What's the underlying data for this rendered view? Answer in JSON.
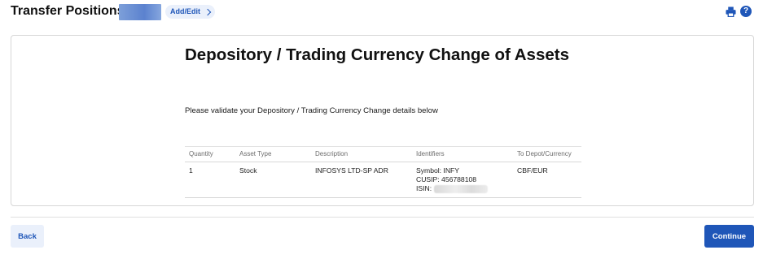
{
  "header": {
    "title": "Transfer Positions",
    "add_edit_label": "Add/Edit"
  },
  "icons": {
    "print": "print-icon",
    "help": "help-icon",
    "help_glyph": "?"
  },
  "card": {
    "title": "Depository / Trading Currency Change of Assets",
    "instructions": "Please validate your Depository / Trading Currency Change details below"
  },
  "table": {
    "headers": [
      "Quantity",
      "Asset Type",
      "Description",
      "Identifiers",
      "To Depot/Currency"
    ],
    "rows": [
      {
        "quantity": "1",
        "asset_type": "Stock",
        "description": "INFOSYS LTD-SP ADR",
        "symbol": "Symbol: INFY",
        "cusip": "CUSIP: 456788108",
        "isin_label": "ISIN:",
        "to_depot": "CBF/EUR"
      }
    ]
  },
  "footer": {
    "back_label": "Back",
    "continue_label": "Continue"
  },
  "colors": {
    "accent": "#1f56b8",
    "accent_light": "#eaf0fb"
  }
}
